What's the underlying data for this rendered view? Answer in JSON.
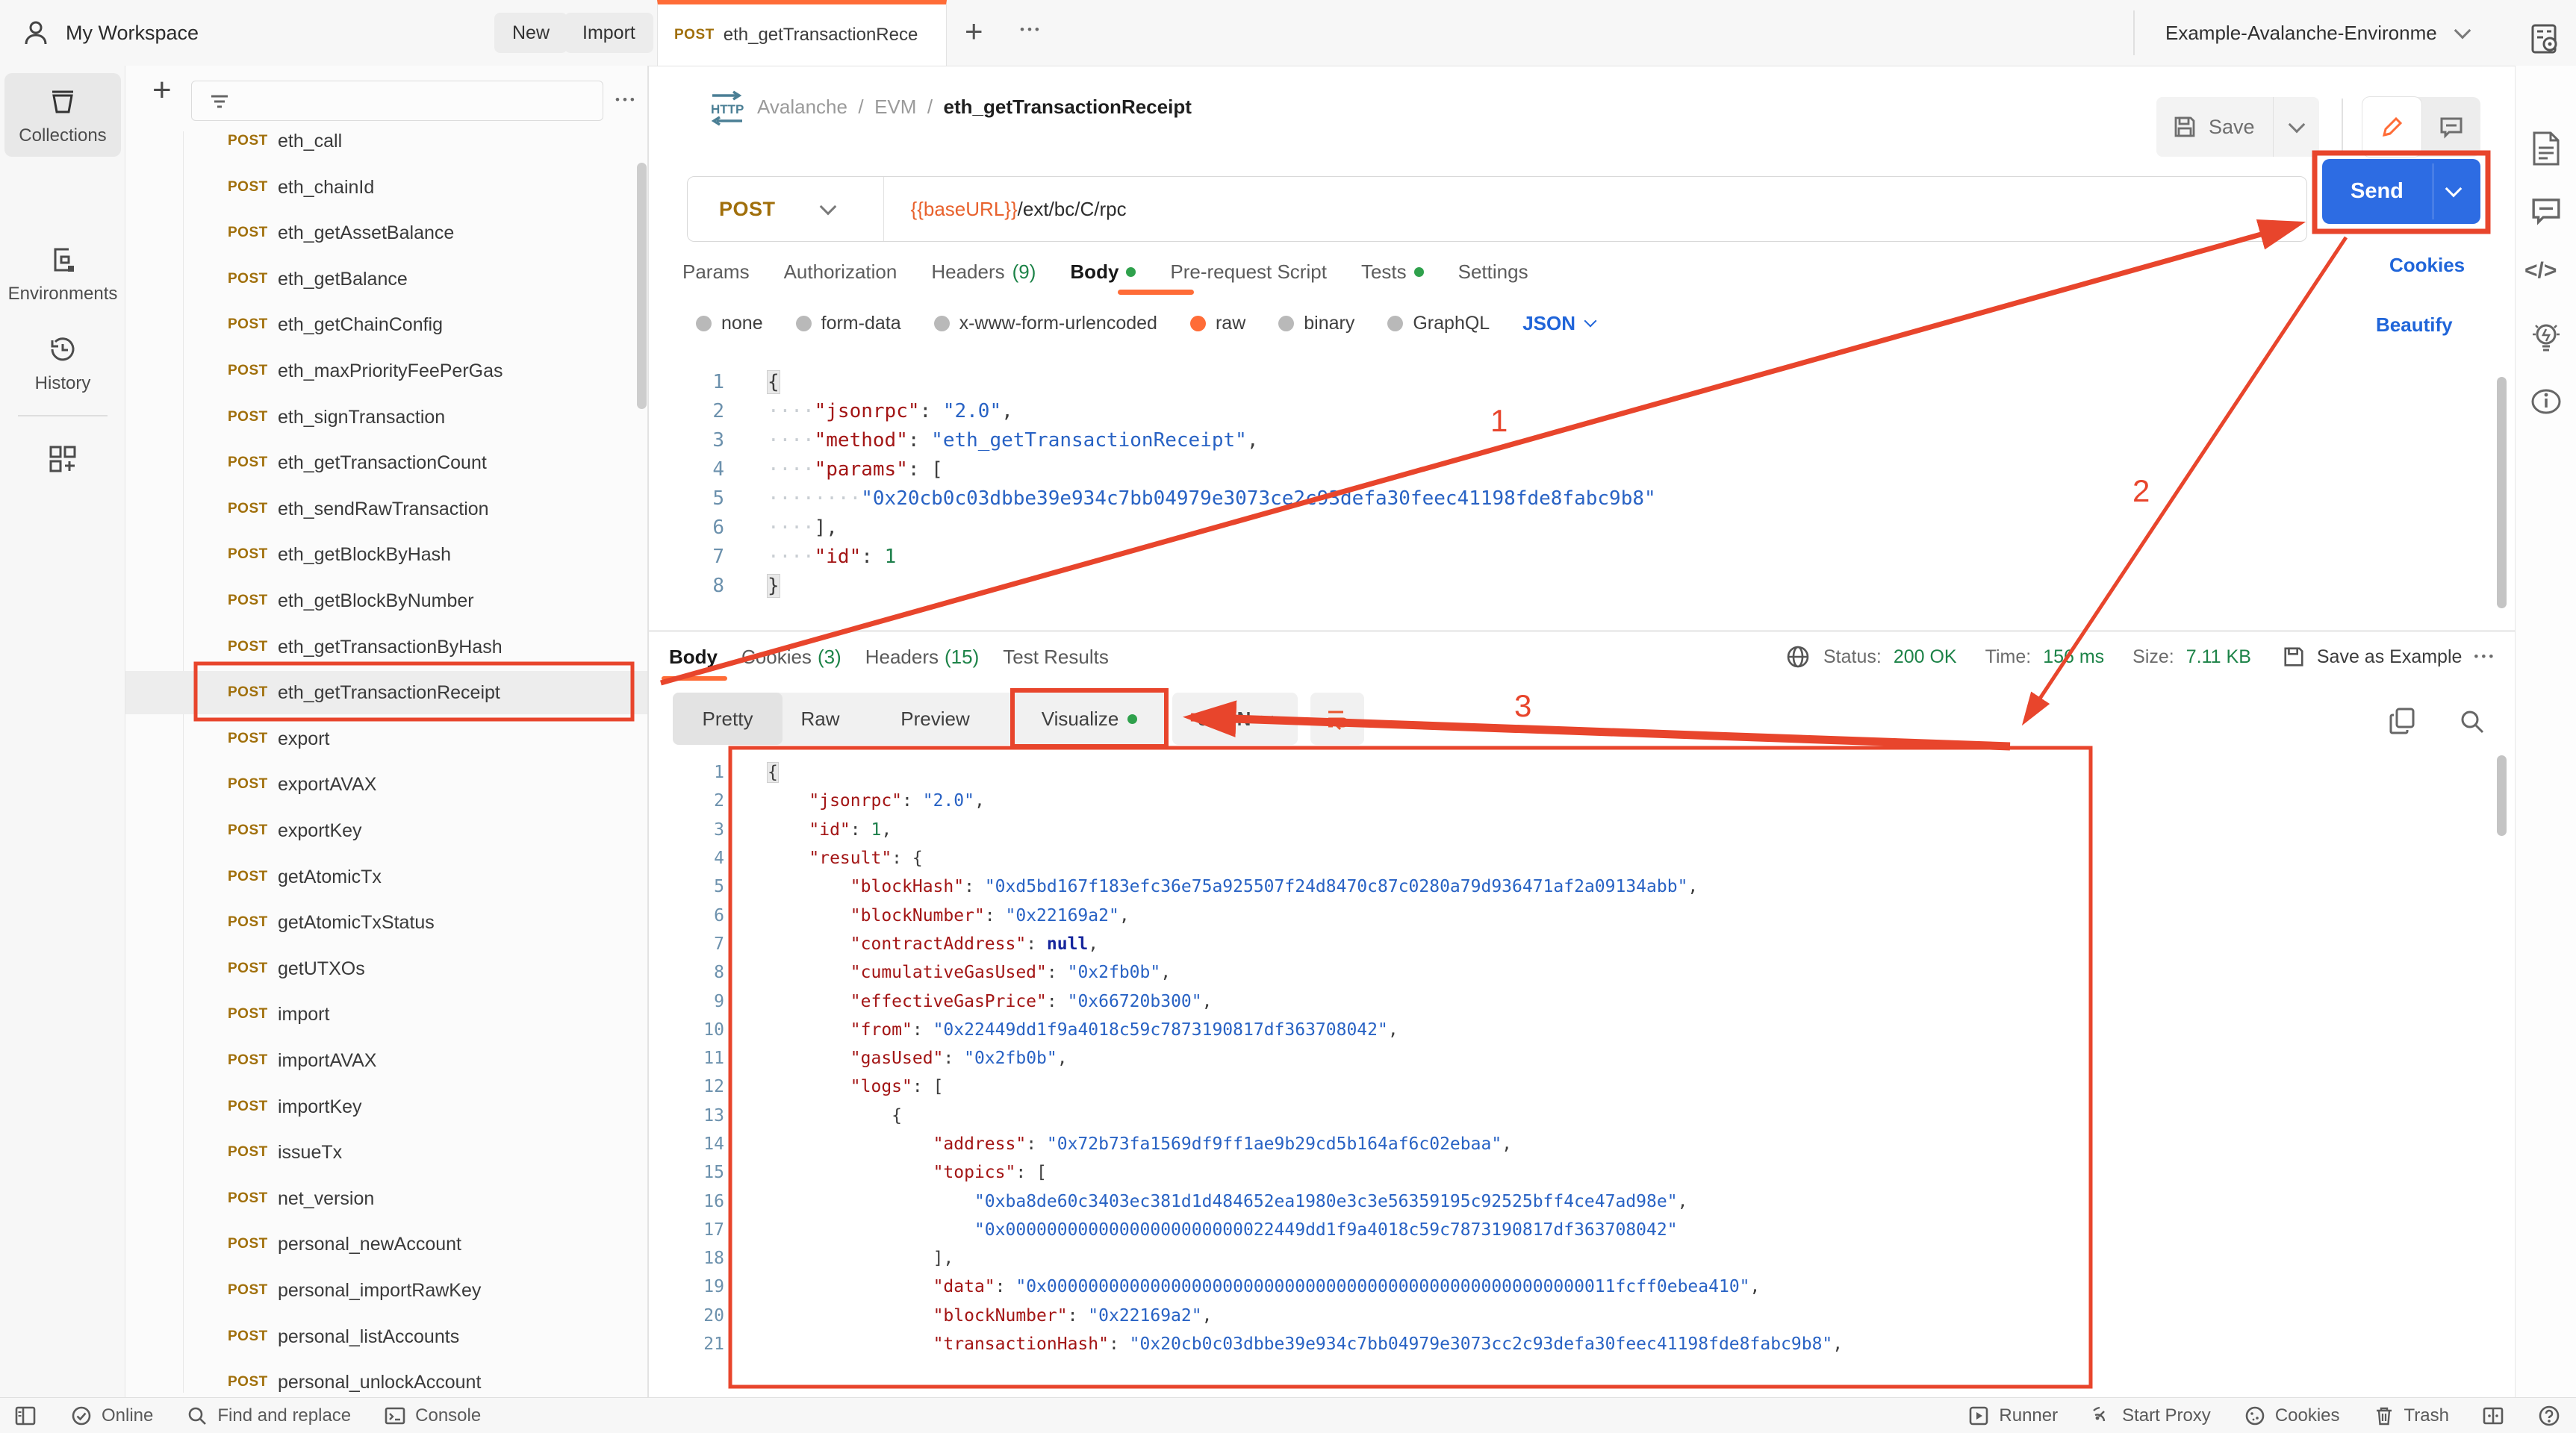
{
  "topbar": {
    "workspace": "My Workspace",
    "new_btn": "New",
    "import_btn": "Import",
    "tab": {
      "method": "POST",
      "title": "eth_getTransactionRece"
    },
    "env_name": "Example-Avalanche-Environme"
  },
  "sidebar": {
    "rail": {
      "collections": "Collections",
      "environments": "Environments",
      "history": "History"
    },
    "method_label": "POST",
    "selected_index": 12,
    "items": [
      "eth_call",
      "eth_chainId",
      "eth_getAssetBalance",
      "eth_getBalance",
      "eth_getChainConfig",
      "eth_maxPriorityFeePerGas",
      "eth_signTransaction",
      "eth_getTransactionCount",
      "eth_sendRawTransaction",
      "eth_getBlockByHash",
      "eth_getBlockByNumber",
      "eth_getTransactionByHash",
      "eth_getTransactionReceipt",
      "export",
      "exportAVAX",
      "exportKey",
      "getAtomicTx",
      "getAtomicTxStatus",
      "getUTXOs",
      "import",
      "importAVAX",
      "importKey",
      "issueTx",
      "net_version",
      "personal_newAccount",
      "personal_importRawKey",
      "personal_listAccounts",
      "personal_unlockAccount"
    ]
  },
  "request": {
    "breadcrumb": {
      "root": "Avalanche",
      "sep": "/",
      "group": "EVM",
      "name": "eth_getTransactionReceipt"
    },
    "save_btn": "Save",
    "method": "POST",
    "url": {
      "variable": "{{baseURL}}",
      "path": "/ext/bc/C/rpc"
    },
    "send_btn": "Send",
    "tabs": [
      {
        "label": "Params"
      },
      {
        "label": "Authorization"
      },
      {
        "label": "Headers",
        "count": "(9)"
      },
      {
        "label": "Body",
        "dot": true,
        "active": true
      },
      {
        "label": "Pre-request Script"
      },
      {
        "label": "Tests",
        "dot": true
      },
      {
        "label": "Settings"
      }
    ],
    "cookies_link": "Cookies",
    "beautify_link": "Beautify",
    "body_modes": [
      {
        "label": "none"
      },
      {
        "label": "form-data"
      },
      {
        "label": "x-www-form-urlencoded"
      },
      {
        "label": "raw",
        "selected": true
      },
      {
        "label": "binary"
      },
      {
        "label": "GraphQL"
      }
    ],
    "raw_language": "JSON",
    "code": [
      [
        [
          "b",
          "{"
        ]
      ],
      [
        [
          "w",
          "····"
        ],
        [
          "k",
          "\"jsonrpc\""
        ],
        [
          "p",
          ": "
        ],
        [
          "s",
          "\"2.0\""
        ],
        [
          "p",
          ","
        ]
      ],
      [
        [
          "w",
          "····"
        ],
        [
          "k",
          "\"method\""
        ],
        [
          "p",
          ": "
        ],
        [
          "s",
          "\"eth_getTransactionReceipt\""
        ],
        [
          "p",
          ","
        ]
      ],
      [
        [
          "w",
          "····"
        ],
        [
          "k",
          "\"params\""
        ],
        [
          "p",
          ": ["
        ]
      ],
      [
        [
          "w",
          "········"
        ],
        [
          "s",
          "\"0x20cb0c03dbbe39e934c7bb04979e3073ce2c93defa30feec41198fde8fabc9b8\""
        ]
      ],
      [
        [
          "w",
          "····"
        ],
        [
          "p",
          "],"
        ]
      ],
      [
        [
          "w",
          "····"
        ],
        [
          "k",
          "\"id\""
        ],
        [
          "p",
          ": "
        ],
        [
          "n",
          "1"
        ]
      ],
      [
        [
          "b",
          "}"
        ]
      ]
    ]
  },
  "response": {
    "tabs": [
      {
        "label": "Body",
        "active": true
      },
      {
        "label": "Cookies",
        "count": "(3)"
      },
      {
        "label": "Headers",
        "count": "(15)"
      },
      {
        "label": "Test Results"
      }
    ],
    "meta": {
      "status_label": "Status:",
      "status": "200 OK",
      "time_label": "Time:",
      "time": "156 ms",
      "size_label": "Size:",
      "size": "7.11 KB",
      "save_as_example": "Save as Example"
    },
    "view_tabs": [
      {
        "label": "Pretty",
        "active": true
      },
      {
        "label": "Raw"
      },
      {
        "label": "Preview"
      },
      {
        "label": "Visualize",
        "dot": true
      }
    ],
    "language": "JSON",
    "code": [
      [
        [
          "b",
          "{"
        ]
      ],
      [
        [
          "i",
          "    "
        ],
        [
          "k",
          "\"jsonrpc\""
        ],
        [
          "p",
          ": "
        ],
        [
          "s",
          "\"2.0\""
        ],
        [
          "p",
          ","
        ]
      ],
      [
        [
          "i",
          "    "
        ],
        [
          "k",
          "\"id\""
        ],
        [
          "p",
          ": "
        ],
        [
          "n",
          "1"
        ],
        [
          "p",
          ","
        ]
      ],
      [
        [
          "i",
          "    "
        ],
        [
          "k",
          "\"result\""
        ],
        [
          "p",
          ": {"
        ]
      ],
      [
        [
          "i",
          "        "
        ],
        [
          "k",
          "\"blockHash\""
        ],
        [
          "p",
          ": "
        ],
        [
          "s",
          "\"0xd5bd167f183efc36e75a925507f24d8470c87c0280a79d936471af2a09134abb\""
        ],
        [
          "p",
          ","
        ]
      ],
      [
        [
          "i",
          "        "
        ],
        [
          "k",
          "\"blockNumber\""
        ],
        [
          "p",
          ": "
        ],
        [
          "s",
          "\"0x22169a2\""
        ],
        [
          "p",
          ","
        ]
      ],
      [
        [
          "i",
          "        "
        ],
        [
          "k",
          "\"contractAddress\""
        ],
        [
          "p",
          ": "
        ],
        [
          "u",
          "null"
        ],
        [
          "p",
          ","
        ]
      ],
      [
        [
          "i",
          "        "
        ],
        [
          "k",
          "\"cumulativeGasUsed\""
        ],
        [
          "p",
          ": "
        ],
        [
          "s",
          "\"0x2fb0b\""
        ],
        [
          "p",
          ","
        ]
      ],
      [
        [
          "i",
          "        "
        ],
        [
          "k",
          "\"effectiveGasPrice\""
        ],
        [
          "p",
          ": "
        ],
        [
          "s",
          "\"0x66720b300\""
        ],
        [
          "p",
          ","
        ]
      ],
      [
        [
          "i",
          "        "
        ],
        [
          "k",
          "\"from\""
        ],
        [
          "p",
          ": "
        ],
        [
          "s",
          "\"0x22449dd1f9a4018c59c7873190817df363708042\""
        ],
        [
          "p",
          ","
        ]
      ],
      [
        [
          "i",
          "        "
        ],
        [
          "k",
          "\"gasUsed\""
        ],
        [
          "p",
          ": "
        ],
        [
          "s",
          "\"0x2fb0b\""
        ],
        [
          "p",
          ","
        ]
      ],
      [
        [
          "i",
          "        "
        ],
        [
          "k",
          "\"logs\""
        ],
        [
          "p",
          ": ["
        ]
      ],
      [
        [
          "i",
          "            "
        ],
        [
          "p",
          "{"
        ]
      ],
      [
        [
          "i",
          "                "
        ],
        [
          "k",
          "\"address\""
        ],
        [
          "p",
          ": "
        ],
        [
          "s",
          "\"0x72b73fa1569df9ff1ae9b29cd5b164af6c02ebaa\""
        ],
        [
          "p",
          ","
        ]
      ],
      [
        [
          "i",
          "                "
        ],
        [
          "k",
          "\"topics\""
        ],
        [
          "p",
          ": ["
        ]
      ],
      [
        [
          "i",
          "                    "
        ],
        [
          "s",
          "\"0xba8de60c3403ec381d1d484652ea1980e3c3e56359195c92525bff4ce47ad98e\""
        ],
        [
          "p",
          ","
        ]
      ],
      [
        [
          "i",
          "                    "
        ],
        [
          "s",
          "\"0x00000000000000000000000022449dd1f9a4018c59c7873190817df363708042\""
        ]
      ],
      [
        [
          "i",
          "                "
        ],
        [
          "p",
          "],"
        ]
      ],
      [
        [
          "i",
          "                "
        ],
        [
          "k",
          "\"data\""
        ],
        [
          "p",
          ": "
        ],
        [
          "s",
          "\"0x0000000000000000000000000000000000000000000000000000011fcff0ebea410\""
        ],
        [
          "p",
          ","
        ]
      ],
      [
        [
          "i",
          "                "
        ],
        [
          "k",
          "\"blockNumber\""
        ],
        [
          "p",
          ": "
        ],
        [
          "s",
          "\"0x22169a2\""
        ],
        [
          "p",
          ","
        ]
      ],
      [
        [
          "i",
          "                "
        ],
        [
          "k",
          "\"transactionHash\""
        ],
        [
          "p",
          ": "
        ],
        [
          "s",
          "\"0x20cb0c03dbbe39e934c7bb04979e3073cc2c93defa30feec41198fde8fabc9b8\""
        ],
        [
          "p",
          ","
        ]
      ]
    ]
  },
  "statusbar": {
    "online": "Online",
    "find": "Find and replace",
    "console": "Console",
    "runner": "Runner",
    "start_proxy": "Start Proxy",
    "cookies": "Cookies",
    "trash": "Trash"
  },
  "annotations": {
    "color": "#e8452c",
    "labels": {
      "one": "1",
      "two": "2",
      "three": "3"
    }
  }
}
